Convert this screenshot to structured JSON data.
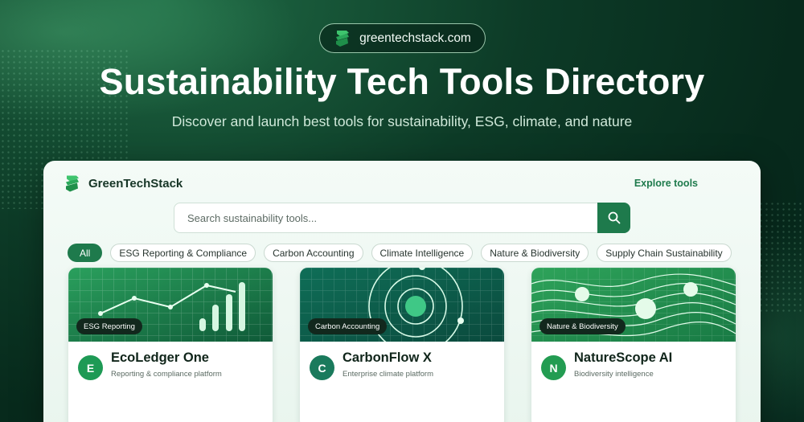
{
  "site": {
    "domain": "greentechstack.com",
    "title": "Sustainability Tech Tools Directory",
    "subtitle": "Discover and launch best tools for sustainability, ESG, climate, and nature"
  },
  "panel": {
    "brand": "GreenTechStack",
    "explore_link": "Explore tools",
    "search": {
      "placeholder": "Search sustainability tools...",
      "value": ""
    },
    "filters": [
      {
        "label": "All",
        "active": true
      },
      {
        "label": "ESG Reporting & Compliance",
        "active": false
      },
      {
        "label": "Carbon Accounting",
        "active": false
      },
      {
        "label": "Climate Intelligence",
        "active": false
      },
      {
        "label": "Nature & Biodiversity",
        "active": false
      },
      {
        "label": "Supply Chain Sustainability",
        "active": false
      }
    ],
    "cards": [
      {
        "tag": "ESG Reporting",
        "initial": "E",
        "name": "EcoLedger One",
        "description": "Reporting & compliance platform",
        "icon": "line-bar-chart-art"
      },
      {
        "tag": "Carbon Accounting",
        "initial": "C",
        "name": "CarbonFlow X",
        "description": "Enterprise climate platform",
        "icon": "orbit-rings-art"
      },
      {
        "tag": "Nature & Biodiversity",
        "initial": "N",
        "name": "NatureScope AI",
        "description": "Biodiversity intelligence",
        "icon": "wave-lines-art"
      }
    ]
  },
  "colors": {
    "accent": "#1e7a4c",
    "bg_dark": "#072a1c",
    "avatar_1": "#1e9a55",
    "avatar_2": "#1a7a5c",
    "avatar_3": "#239c52"
  }
}
